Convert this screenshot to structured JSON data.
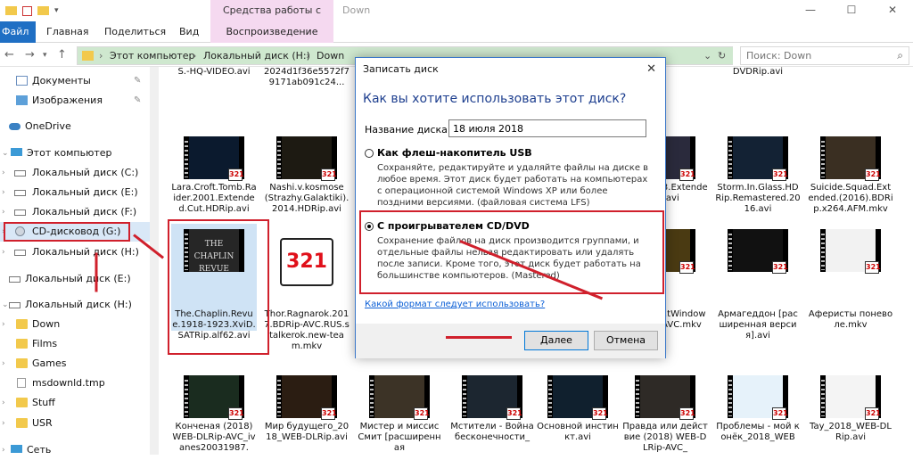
{
  "window": {
    "title": "Down",
    "context_group": "Средства работы с видео"
  },
  "ribbon": {
    "tabs": [
      "Файл",
      "Главная",
      "Поделиться",
      "Вид",
      "Воспроизведение"
    ]
  },
  "address": {
    "crumbs": [
      "Этот компьютер",
      "Локальный диск (H:)",
      "Down"
    ],
    "search_placeholder": "Поиск: Down"
  },
  "sidebar": {
    "items": [
      {
        "label": "Документы",
        "icon": "document-icon",
        "pinned": true
      },
      {
        "label": "Изображения",
        "icon": "pictures-icon",
        "pinned": true
      },
      {
        "label": "OneDrive",
        "icon": "cloud-icon"
      },
      {
        "label": "Этот компьютер",
        "icon": "computer-icon"
      },
      {
        "label": "Локальный диск (C:)",
        "icon": "drive-icon"
      },
      {
        "label": "Локальный диск (E:)",
        "icon": "drive-icon"
      },
      {
        "label": "Локальный диск (F:)",
        "icon": "drive-icon"
      },
      {
        "label": "CD-дисковод (G:)",
        "icon": "cd-drive-icon",
        "selected": true
      },
      {
        "label": "Локальный диск (H:)",
        "icon": "drive-icon"
      },
      {
        "label": "Локальный диск (E:)",
        "icon": "drive-icon"
      },
      {
        "label": "Локальный диск (H:)",
        "icon": "drive-icon"
      },
      {
        "label": "Down",
        "icon": "folder-icon"
      },
      {
        "label": "Films",
        "icon": "folder-icon"
      },
      {
        "label": "Games",
        "icon": "folder-icon"
      },
      {
        "label": "msdownld.tmp",
        "icon": "file-icon"
      },
      {
        "label": "Stuff",
        "icon": "folder-icon"
      },
      {
        "label": "USR",
        "icon": "folder-icon"
      },
      {
        "label": "Сеть",
        "icon": "network-icon"
      }
    ]
  },
  "files": {
    "row0": [
      "S.-HQ-VIDEO.avi",
      "2024d1f36e5572f79171ab091c24...",
      "",
      "",
      "",
      "",
      "DVDRip.avi"
    ],
    "row1": [
      "Lara.Croft.Tomb.Raider.2001.Extended.Cut.HDRip.avi",
      "Nashi.v.kosmose (Strazhy.Galaktiki).2014.HDRip.avi",
      "",
      "",
      "rs.VI.1983.Extended.t.avi",
      "Storm.In.Glass.HDRip.Remastered.2016.avi",
      "Suicide.Squad.Extended.(2016).BDRip.x264.AFM.mkv"
    ],
    "row2": [
      "The.Chaplin.Revue.1918-1923.XviD.SATRip.alf62.avi",
      "Thor.Ragnarok.2017.BDRip-AVC.RUS.stalkerok.new-team.mkv",
      "",
      "",
      "We.Do.in.tWindows.2014.AVC.mkv",
      "Армагеддон [расширенная версия].avi",
      "Аферисты поневоле.mkv"
    ],
    "row3": [
      "Конченая (2018) WEB-DLRip-AVC_ivanes20031987.",
      "Мир будущего_2018_WEB-DLRip.avi",
      "Мистер и миссис Смит [расширенная",
      "Мстители - Война бесконечности_",
      "Основной инстинкт.avi",
      "Правда или действие (2018) WEB-DLRip-AVC_",
      "Проблемы - мой конёк_2018_WEB",
      "Tay_2018_WEB-DLRip.avi"
    ]
  },
  "dialog": {
    "title": "Записать диск",
    "question": "Как вы хотите использовать этот диск?",
    "name_label": "Название диска:",
    "name_value": "18 июля 2018",
    "opt1_title": "Как флеш-накопитель USB",
    "opt1_desc": "Сохраняйте, редактируйте и удаляйте файлы на диске в любое время. Этот диск будет работать на компьютерах с операционной системой Windows XP или более поздними версиями. (файловая система LFS)",
    "opt2_title": "С проигрывателем CD/DVD",
    "opt2_desc": "Сохранение файлов на диск производится группами, и отдельные файлы нельзя редактировать или удалять после записи. Кроме того, этот диск будет работать на большинстве компьютеров. (Mastered)",
    "link": "Какой формат следует использовать?",
    "next": "Далее",
    "cancel": "Отмена"
  },
  "badge_text": "321",
  "thumb_overlay": "THE CHAPLIN REVUE",
  "colors": {
    "accent": "#1f6fc4",
    "annotation": "#d0202c",
    "context_tab": "#f5d9f0"
  }
}
